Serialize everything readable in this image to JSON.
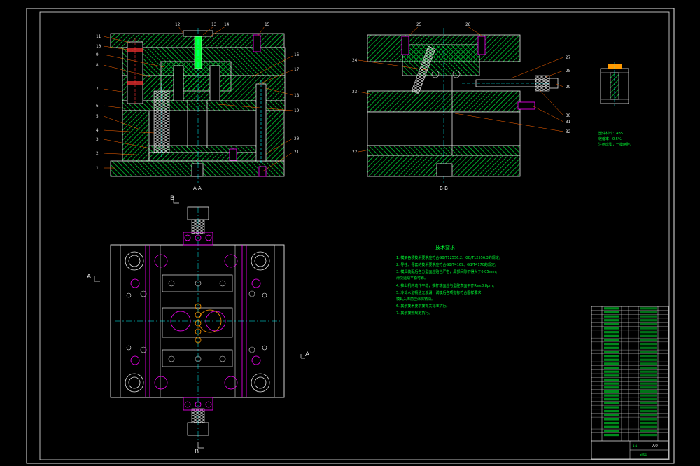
{
  "section_aa": {
    "label": "A-A",
    "part_numbers_left": [
      "11",
      "10",
      "9",
      "8",
      "7",
      "6",
      "5",
      "4",
      "3",
      "2",
      "1"
    ],
    "part_numbers_top": [
      "12",
      "13",
      "14",
      "15"
    ],
    "part_numbers_right": [
      "16",
      "17",
      "18",
      "19",
      "20",
      "21"
    ]
  },
  "section_bb": {
    "label": "B-B",
    "part_numbers_top": [
      "25",
      "26"
    ],
    "part_numbers_left": [
      "24",
      "23",
      "22"
    ],
    "part_numbers_right": [
      "27",
      "28",
      "29",
      "30",
      "31",
      "32"
    ]
  },
  "plan_view": {
    "section_mark_a": "A",
    "section_mark_b": "B"
  },
  "notes_block": {
    "title": "技术要求",
    "items": [
      "1. 模架各项技术要求应符合GB/T12556.2、GB/T12556.3的规定。",
      "2. 导柱、导套的技术要求应符合GB/T4169、GB/T4170的规定。",
      "3. 模具装配后各分型面应贴合严密，局部间隙不得大于0.05mm。",
      "   滑块运动平稳可靠。",
      "4. 推出机构动作平稳，推杆端面应与型腔表面平齐Ra≤0.8μm。",
      "5. 冷却水道畅通无渗漏，试模后各项指标符合图样要求，",
      "   模具入库前应涂防锈油。",
      "6. 其余技术要求按有关标准执行。",
      "7. 其余按照规定执行。"
    ]
  },
  "side_note": [
    "塑件材料：ABS",
    "收缩率：0.5%",
    "注射成型，一模两腔。"
  ],
  "title_block": {
    "scale": "1:1",
    "sheet": "A0",
    "drawing_no": "SJ-01",
    "rows": 34
  },
  "colors": {
    "background": "#000000",
    "hatch": "#00cc33",
    "outline": "#e6e6e6",
    "magenta": "#ff00ff",
    "cyan": "#00ffff",
    "leader": "#ff6600",
    "text_green": "#00ff33"
  }
}
